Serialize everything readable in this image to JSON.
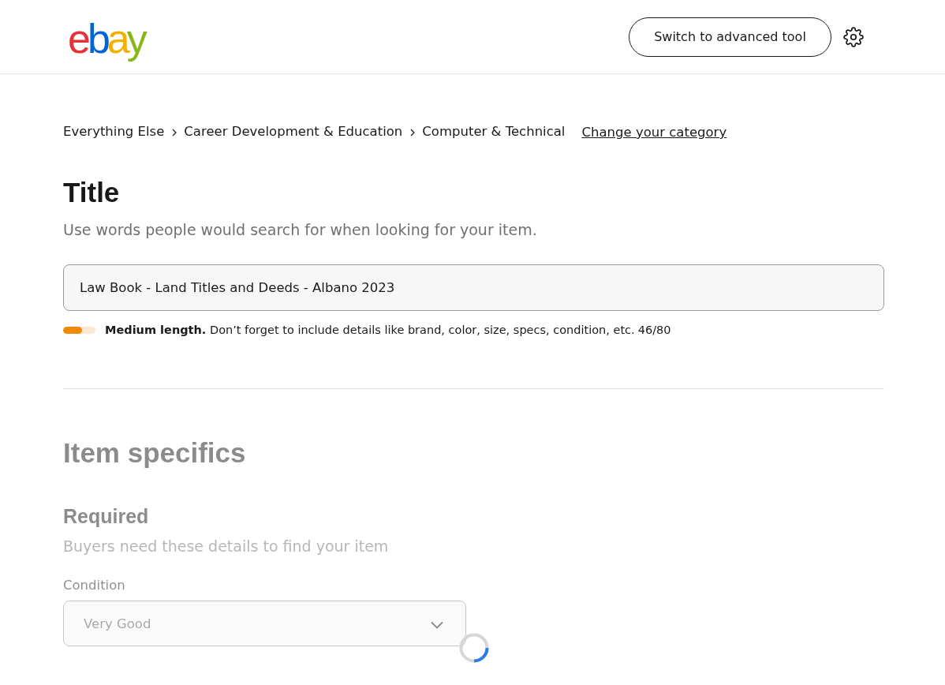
{
  "header": {
    "logo": "ebay",
    "button": "Switch to advanced tool"
  },
  "breadcrumb": {
    "items": [
      "Everything Else",
      "Career Development & Education",
      "Computer & Technical"
    ],
    "link": "Change your category"
  },
  "title_section": {
    "heading": "Title",
    "description": "Use words people would search for when looking for your item.",
    "field": {
      "value": "Law Book - Land Titles and Deeds - Albano 2023"
    },
    "length_meter": {
      "level": 0.575
    },
    "hint": "**Medium length.** Don’t forget to include details like brand, color, size, specs, condition, etc.",
    "counter": "46/80"
  },
  "item_specifics": {
    "heading": "Item specifics",
    "loading": true,
    "subheading": "Required",
    "description": "Buyers need these details to find your item",
    "fields": [
      {
        "label": "Condition",
        "kind": "select",
        "value": "Very Good"
      }
    ]
  }
}
